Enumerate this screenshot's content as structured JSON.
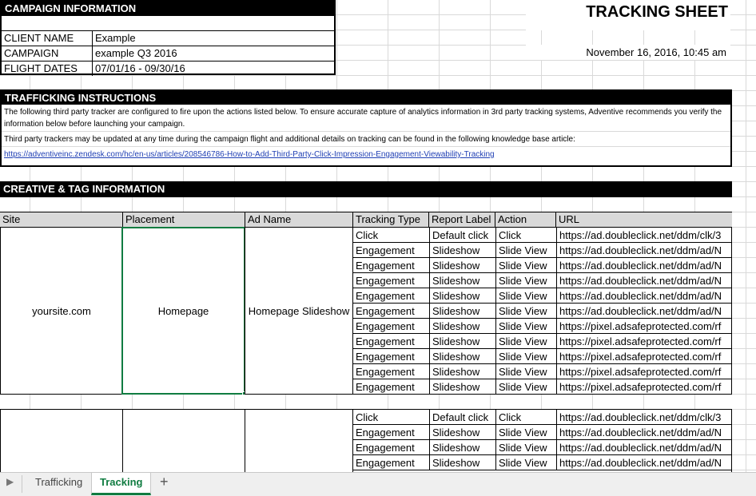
{
  "campaign_info": {
    "title": "CAMPAIGN INFORMATION",
    "rows": [
      {
        "label": "CLIENT NAME",
        "value": "Example"
      },
      {
        "label": "CAMPAIGN",
        "value": "example Q3 2016"
      },
      {
        "label": "FLIGHT DATES",
        "value": "07/01/16 - 09/30/16"
      }
    ]
  },
  "sheet_title": "TRACKING SHEET",
  "generated_date": "November 16, 2016, 10:45 am",
  "trafficking": {
    "title": "TRAFFICKING INSTRUCTIONS",
    "paragraph1": "The following third party tracker are configured to fire upon the actions listed below. To ensure accurate capture of analytics information in 3rd party tracking systems, Adventive recommends you verify the information below before launching your campaign.",
    "paragraph2": "Third party trackers may be updated at any time during the campaign flight and additional details on tracking can be found in the following knowledge base article:",
    "link": "https://adventiveinc.zendesk.com/hc/en-us/articles/208546786-How-to-Add-Third-Party-Click-Impression-Engagement-Viewability-Tracking"
  },
  "creative": {
    "title": "CREATIVE & TAG INFORMATION",
    "headers": [
      "Site",
      "Placement",
      "Ad Name",
      "Tracking Type",
      "Report Label",
      "Action",
      "URL"
    ],
    "group1": {
      "site": "yoursite.com",
      "placement": "Homepage",
      "ad_name": "Homepage Slideshow",
      "rows": [
        [
          "Click",
          "Default click",
          "Click",
          "https://ad.doubleclick.net/ddm/clk/3"
        ],
        [
          "Engagement",
          "Slideshow",
          "Slide View",
          "https://ad.doubleclick.net/ddm/ad/N"
        ],
        [
          "Engagement",
          "Slideshow",
          "Slide View",
          "https://ad.doubleclick.net/ddm/ad/N"
        ],
        [
          "Engagement",
          "Slideshow",
          "Slide View",
          "https://ad.doubleclick.net/ddm/ad/N"
        ],
        [
          "Engagement",
          "Slideshow",
          "Slide View",
          "https://ad.doubleclick.net/ddm/ad/N"
        ],
        [
          "Engagement",
          "Slideshow",
          "Slide View",
          "https://ad.doubleclick.net/ddm/ad/N"
        ],
        [
          "Engagement",
          "Slideshow",
          "Slide View",
          "https://pixel.adsafeprotected.com/rf"
        ],
        [
          "Engagement",
          "Slideshow",
          "Slide View",
          "https://pixel.adsafeprotected.com/rf"
        ],
        [
          "Engagement",
          "Slideshow",
          "Slide View",
          "https://pixel.adsafeprotected.com/rf"
        ],
        [
          "Engagement",
          "Slideshow",
          "Slide View",
          "https://pixel.adsafeprotected.com/rf"
        ],
        [
          "Engagement",
          "Slideshow",
          "Slide View",
          "https://pixel.adsafeprotected.com/rf"
        ]
      ]
    },
    "group2": {
      "rows": [
        [
          "Click",
          "Default click",
          "Click",
          "https://ad.doubleclick.net/ddm/clk/3"
        ],
        [
          "Engagement",
          "Slideshow",
          "Slide View",
          "https://ad.doubleclick.net/ddm/ad/N"
        ],
        [
          "Engagement",
          "Slideshow",
          "Slide View",
          "https://ad.doubleclick.net/ddm/ad/N"
        ],
        [
          "Engagement",
          "Slideshow",
          "Slide View",
          "https://ad.doubleclick.net/ddm/ad/N"
        ]
      ]
    }
  },
  "tabs": {
    "items": [
      "Trafficking",
      "Tracking"
    ],
    "active": "Tracking",
    "add_icon": "+",
    "scroll_icon": "▶"
  },
  "colors": {
    "accent": "#107c41",
    "header_fill": "#d9d9d9",
    "link": "#1f3fb4"
  }
}
